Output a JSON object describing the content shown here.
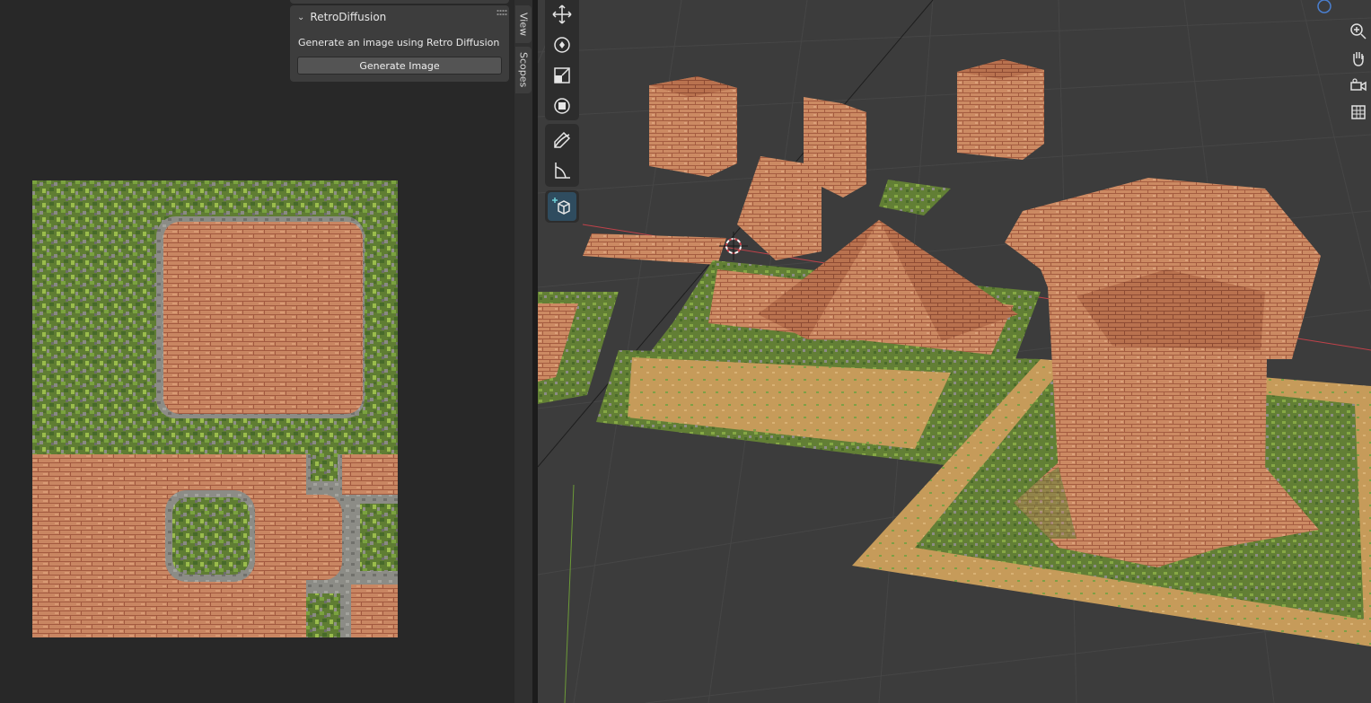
{
  "panel": {
    "title": "RetroDiffusion",
    "description": "Generate an image using Retro Diffusion",
    "generate_button": "Generate Image"
  },
  "sidebar_tabs": {
    "view": "View",
    "scopes": "Scopes"
  },
  "tools": [
    {
      "name": "move-tool",
      "icon": "move-icon"
    },
    {
      "name": "rotate-tool",
      "icon": "rotate-icon"
    },
    {
      "name": "scale-tool",
      "icon": "scale-icon"
    },
    {
      "name": "transform-tool",
      "icon": "transform-icon"
    },
    {
      "name": "annotate-tool",
      "icon": "annotate-icon"
    },
    {
      "name": "measure-tool",
      "icon": "measure-icon"
    },
    {
      "name": "add-cube-tool",
      "icon": "add-cube-icon"
    }
  ],
  "nav_gizmos": [
    {
      "name": "zoom-gizmo",
      "icon": "zoom-icon"
    },
    {
      "name": "pan-gizmo",
      "icon": "hand-icon"
    },
    {
      "name": "camera-gizmo",
      "icon": "camera-icon"
    },
    {
      "name": "ortho-gizmo",
      "icon": "grid-icon"
    }
  ],
  "colors": {
    "brick": "#c98a62",
    "brick_dark": "#a8644a",
    "grass": "#6f8f3a",
    "stone": "#8f8f8a",
    "sand": "#c9a05c",
    "accent_active_tool": "#2f4c5f",
    "x_axis": "#d0434b",
    "y_axis": "#79a83a"
  }
}
